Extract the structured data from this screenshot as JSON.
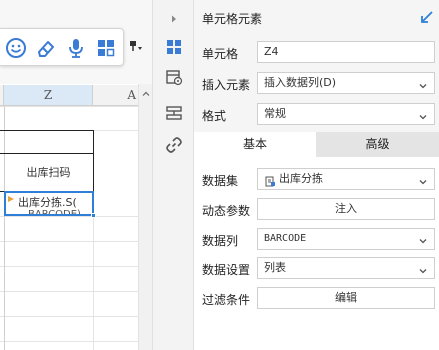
{
  "sheet": {
    "columns": {
      "z": "Z",
      "a": "A"
    },
    "cells": {
      "scan_label": "出库扫码",
      "selected_line1": "出库分拣.S(",
      "selected_line2": "BARCODE)"
    }
  },
  "panel": {
    "title": "单元格元素",
    "cell_label": "单元格",
    "cell_value": "Z4",
    "insert_label": "插入元素",
    "insert_value": "插入数据列(D)",
    "format_label": "格式",
    "format_value": "常规",
    "tabs": {
      "basic": "基本",
      "advanced": "高级"
    },
    "basic": {
      "dataset_label": "数据集",
      "dataset_value": "出库分拣",
      "param_label": "动态参数",
      "param_button": "注入",
      "column_label": "数据列",
      "column_value": "BARCODE",
      "setting_label": "数据设置",
      "setting_value": "列表",
      "filter_label": "过滤条件",
      "filter_button": "编辑"
    }
  },
  "colors": {
    "accent": "#2f7ed8",
    "toolbar_blue": "#3a7bd5",
    "selected_header": "#dbe8f6"
  }
}
